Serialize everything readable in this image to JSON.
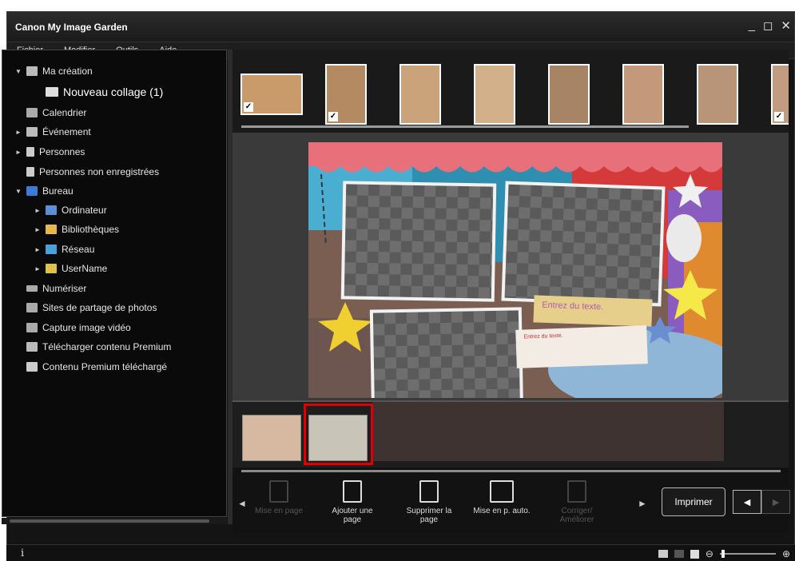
{
  "window": {
    "title": "Canon My Image Garden",
    "controls": [
      "_",
      "◻",
      "✕"
    ]
  },
  "menu": [
    "Fichier",
    "Modifier",
    "Outils",
    "Aide"
  ],
  "sidebar": {
    "items": [
      {
        "label": "Ma création",
        "arrow": "▼",
        "icon": "creation-icon"
      },
      {
        "label": "Nouveau collage (1)",
        "arrow": "",
        "icon": "collage-icon"
      },
      {
        "label": "Calendrier",
        "arrow": "",
        "icon": "calendar-icon"
      },
      {
        "label": "Événement",
        "arrow": "►",
        "icon": "event-icon"
      },
      {
        "label": "Personnes",
        "arrow": "►",
        "icon": "person-icon"
      },
      {
        "label": "Personnes non enregistrées",
        "arrow": "",
        "icon": "person-unregistered-icon"
      },
      {
        "label": "Bureau",
        "arrow": "▼",
        "icon": "desktop-icon"
      },
      {
        "label": "Ordinateur",
        "arrow": "►",
        "icon": "computer-icon"
      },
      {
        "label": "Bibliothèques",
        "arrow": "►",
        "icon": "library-icon"
      },
      {
        "label": "Réseau",
        "arrow": "►",
        "icon": "network-icon"
      },
      {
        "label": "UserName",
        "arrow": "►",
        "icon": "user-folder-icon"
      },
      {
        "label": "Numériser",
        "arrow": "",
        "icon": "scan-icon"
      },
      {
        "label": "Sites de partage de photos",
        "arrow": "",
        "icon": "photo-sharing-icon"
      },
      {
        "label": "Capture image vidéo",
        "arrow": "",
        "icon": "video-capture-icon"
      },
      {
        "label": "Télécharger contenu Premium",
        "arrow": "",
        "icon": "download-premium-icon"
      },
      {
        "label": "Contenu Premium téléchargé",
        "arrow": "",
        "icon": "premium-folder-icon"
      }
    ]
  },
  "editor": {
    "text_placeholder_large": "Entrez du texte.",
    "text_placeholder_small": "Entrez du texte."
  },
  "toolbar": {
    "layout": "Mise en page",
    "add_page": "Ajouter une page",
    "delete_page": "Supprimer la page",
    "auto_layout": "Mise en p. auto.",
    "correct": "Corriger/ Améliorer",
    "print": "Imprimer",
    "prev": "◄",
    "next": "►"
  },
  "status": {
    "info": "i",
    "zoom_minus": "⊖",
    "zoom_plus": "⊕"
  },
  "colors": {
    "highlight": "#e00000",
    "background": "#141414"
  }
}
